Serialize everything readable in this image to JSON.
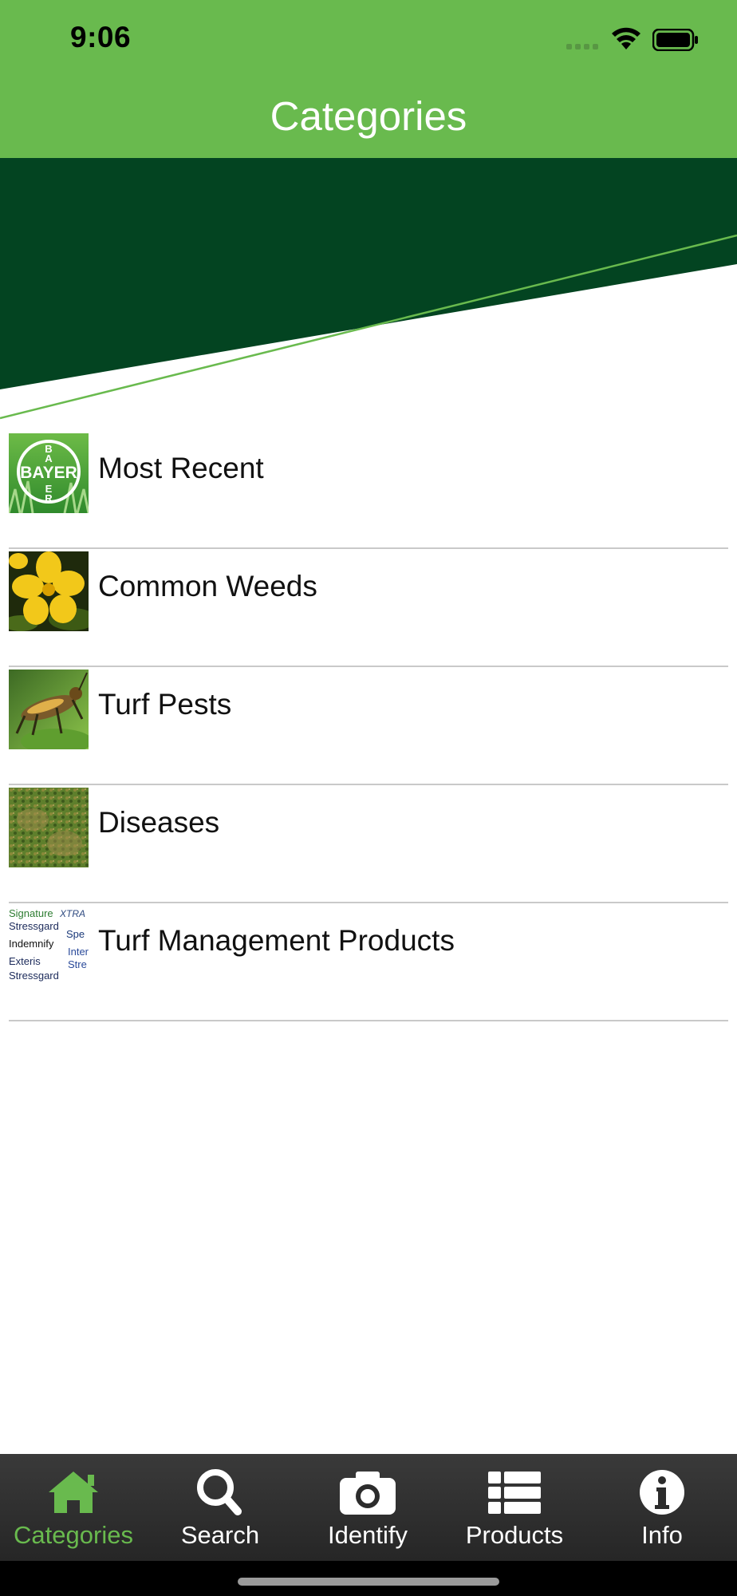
{
  "status": {
    "time": "9:06"
  },
  "header": {
    "title": "Categories"
  },
  "brand": {
    "primary_green": "#69ba4e",
    "dark_green": "#034421"
  },
  "categories": [
    {
      "label": "Most Recent",
      "thumb": "bayer-logo-icon"
    },
    {
      "label": "Common Weeds",
      "thumb": "yellow-flower-photo"
    },
    {
      "label": "Turf Pests",
      "thumb": "grasshopper-photo"
    },
    {
      "label": "Diseases",
      "thumb": "diseased-turf-photo"
    },
    {
      "label": "Turf Management Products",
      "thumb": "product-names-photo"
    }
  ],
  "product_thumb_text": [
    "Signature",
    "XTRA",
    "Stressgard",
    "Spe",
    "Indemnify",
    "Inter",
    "Exteris",
    "Stre",
    "Stressgard"
  ],
  "logo_text": "BAYER",
  "tabs": [
    {
      "label": "Categories",
      "icon": "home-icon",
      "active": true
    },
    {
      "label": "Search",
      "icon": "search-icon",
      "active": false
    },
    {
      "label": "Identify",
      "icon": "camera-icon",
      "active": false
    },
    {
      "label": "Products",
      "icon": "list-icon",
      "active": false
    },
    {
      "label": "Info",
      "icon": "info-icon",
      "active": false
    }
  ]
}
